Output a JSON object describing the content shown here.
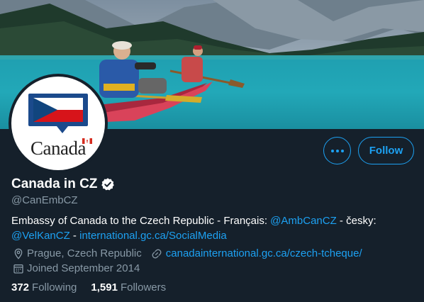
{
  "banner": {
    "description_icon": "canoe-lake-photo"
  },
  "avatar": {
    "wordmark": "Canada"
  },
  "actions": {
    "more_icon": "more-horizontal-icon",
    "follow_label": "Follow"
  },
  "profile": {
    "display_name": "Canada in CZ",
    "verified_icon": "verified-badge-icon",
    "handle": "@CanEmbCZ"
  },
  "bio": {
    "text_1": "Embassy of Canada to the Czech Republic - Français: ",
    "mention_1": "@AmbCanCZ",
    "text_2": " - česky:",
    "mention_2": "@VelKanCZ",
    "text_3": " - ",
    "link_1": "international.gc.ca/SocialMedia"
  },
  "meta": {
    "location": "Prague, Czech Republic",
    "website": "canadainternational.gc.ca/czech-tcheque/",
    "joined": "Joined September 2014"
  },
  "counts": {
    "following_num": "372",
    "following_label": "Following",
    "followers_num": "1,591",
    "followers_label": "Followers"
  },
  "colors": {
    "background": "#15202b",
    "accent": "#1da1f2",
    "secondary_text": "#8899a6"
  }
}
